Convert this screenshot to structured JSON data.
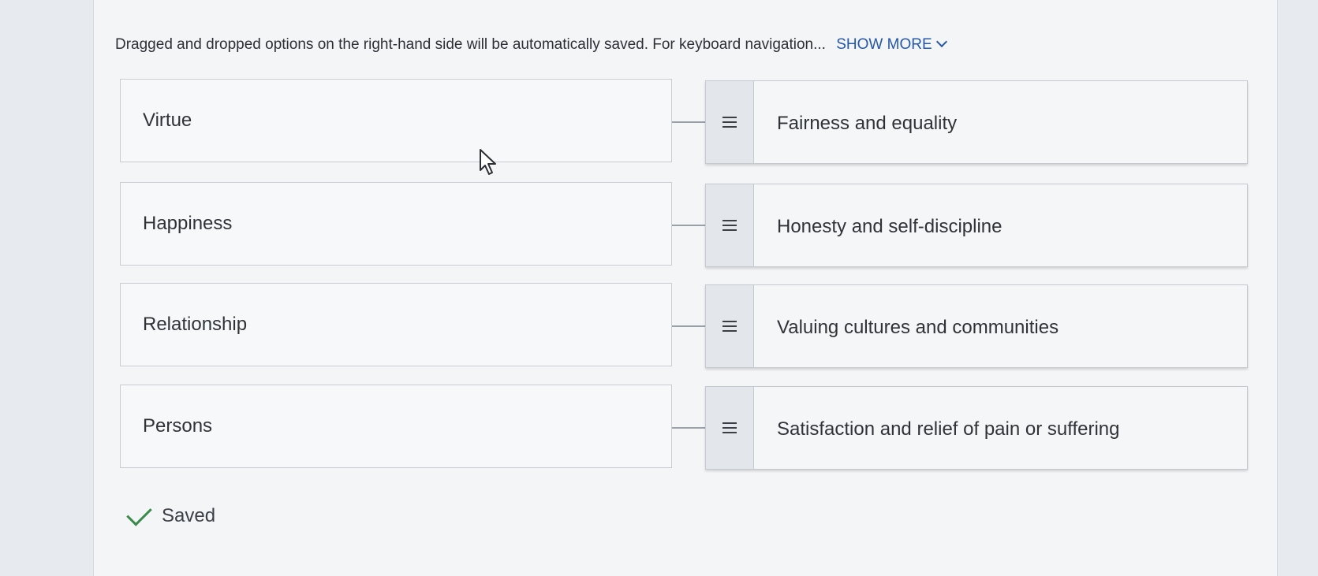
{
  "instructions": {
    "text": "Dragged and dropped options on the right-hand side will be automatically saved. For keyboard navigation...",
    "show_more_label": "SHOW MORE"
  },
  "pairs": [
    {
      "term": "Virtue",
      "match": "Fairness and equality"
    },
    {
      "term": "Happiness",
      "match": "Honesty and self-discipline"
    },
    {
      "term": "Relationship",
      "match": "Valuing cultures and communities"
    },
    {
      "term": "Persons",
      "match": "Satisfaction and relief of pain or suffering"
    }
  ],
  "status": {
    "saved_label": "Saved"
  },
  "icons": {
    "show_more": "chevron-down-icon",
    "drag_handle": "drag-handle-icon",
    "saved": "check-icon",
    "cursor": "mouse-pointer-icon"
  }
}
